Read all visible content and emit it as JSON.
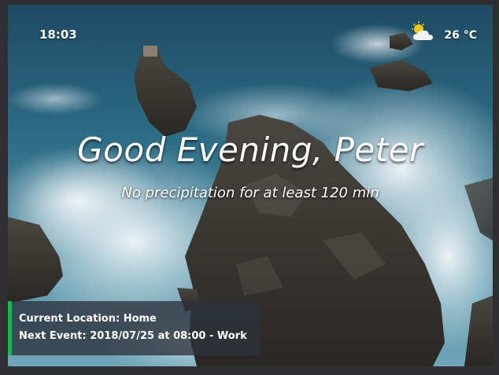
{
  "clock": {
    "time": "18:03"
  },
  "weather": {
    "icon": "partly-cloudy-icon",
    "temperature": "26 °C"
  },
  "greeting": {
    "text": "Good Evening, Peter"
  },
  "precipitation": {
    "text": "No precipitation for at least 120 min"
  },
  "info": {
    "location_text": "Current Location: Home",
    "next_event_text": "Next Event: 2018/07/25 at 08:00 - Work"
  },
  "colors": {
    "accent": "#22b14c",
    "panel": "#2d323c",
    "frame": "#2f2f31"
  }
}
